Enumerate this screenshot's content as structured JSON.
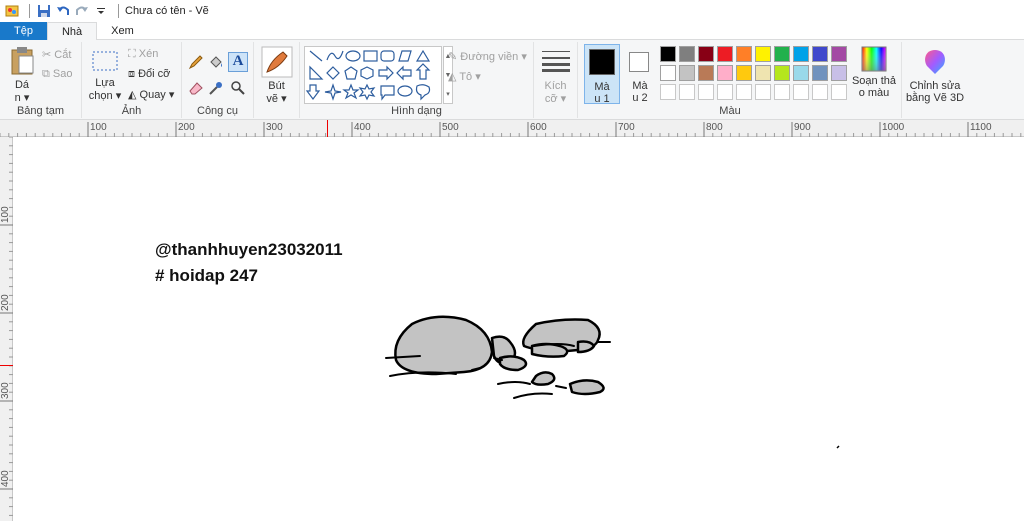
{
  "window": {
    "title": "Chưa có tên - Vẽ"
  },
  "tabs": {
    "file": "Tệp",
    "home": "Nhà",
    "view": "Xem"
  },
  "clipboard": {
    "paste": "Dá",
    "paste2": "n",
    "cut": "Cắt",
    "copy": "Sao",
    "label": "Bảng tạm"
  },
  "image": {
    "select": "Lựa",
    "select2": "chọn",
    "crop": "Xén",
    "resize": "Đổi cỡ",
    "rotate": "Quay",
    "label": "Ảnh"
  },
  "tools": {
    "label": "Công cụ"
  },
  "brushes": {
    "label": "Bút",
    "label2": "vẽ"
  },
  "shapes": {
    "outline": "Đường viền",
    "fill": "Tô",
    "label": "Hình dạng"
  },
  "size": {
    "label": "Kích",
    "label2": "cỡ"
  },
  "colors": {
    "color1": "Mà",
    "color1b": "u 1",
    "color2": "Mà",
    "color2b": "u 2",
    "edit": "Soạn thả",
    "edit2": "o màu",
    "label": "Màu",
    "row1": [
      "#000000",
      "#7f7f7f",
      "#880015",
      "#ed1c24",
      "#ff7f27",
      "#fff200",
      "#22b14c",
      "#00a2e8",
      "#3f48cc",
      "#a349a4"
    ],
    "row2": [
      "#ffffff",
      "#c3c3c3",
      "#b97a57",
      "#ffaec9",
      "#ffc90e",
      "#efe4b0",
      "#b5e61d",
      "#99d9ea",
      "#7092be",
      "#c8bfe7"
    ]
  },
  "paint3d": {
    "label": "Chỉnh sửa",
    "label2": "bằng Vẽ 3D"
  },
  "ruler_h": [
    "100",
    "200",
    "300",
    "400",
    "500",
    "600",
    "700",
    "800",
    "900",
    "1000",
    "1100"
  ],
  "ruler_v": [
    "100",
    "200",
    "300",
    "400"
  ],
  "canvas_text": {
    "line1": "@thanhhuyen23032011",
    "line2": "# hoidap 247"
  }
}
